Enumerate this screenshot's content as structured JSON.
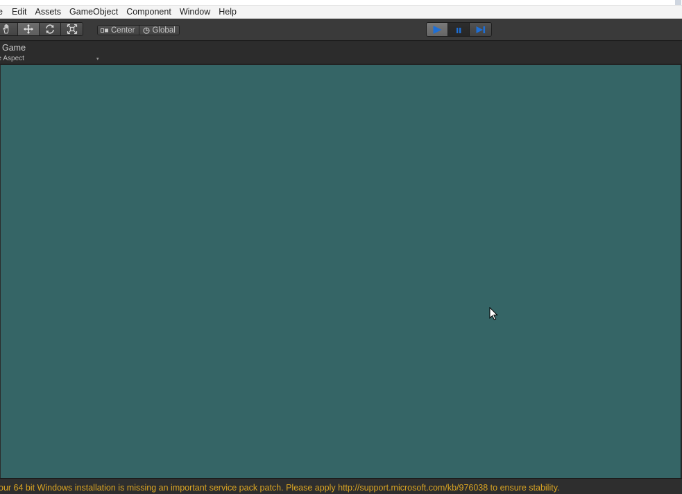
{
  "menu": {
    "items": [
      {
        "label": "e"
      },
      {
        "label": "Edit"
      },
      {
        "label": "Assets"
      },
      {
        "label": "GameObject"
      },
      {
        "label": "Component"
      },
      {
        "label": "Window"
      },
      {
        "label": "Help"
      }
    ]
  },
  "toolbar": {
    "transform_tools": [
      {
        "icon": "hand-icon",
        "active": false
      },
      {
        "icon": "move-icon",
        "active": true
      },
      {
        "icon": "rotate-icon",
        "active": false
      },
      {
        "icon": "scale-icon",
        "active": false
      }
    ],
    "pivot_mode": "Center",
    "pivot_rotation": "Global",
    "play_controls": {
      "play": {
        "icon": "play-icon",
        "active": true
      },
      "pause": {
        "icon": "pause-icon",
        "active": false
      },
      "step": {
        "icon": "step-icon",
        "active": false
      }
    }
  },
  "game_view": {
    "tab_label": "Game",
    "aspect_label": "ee Aspect",
    "aspect_arrow": "▾",
    "background_color": "#356566"
  },
  "status": {
    "message": "our 64 bit Windows installation is missing an important service pack patch. Please apply http://support.microsoft.com/kb/976038 to ensure stability.",
    "color": "#d9a423"
  },
  "colors": {
    "accent_blue": "#1e6fd6",
    "toolbar_bg": "#3a3a3a",
    "header_bg": "#2c2c2c"
  }
}
